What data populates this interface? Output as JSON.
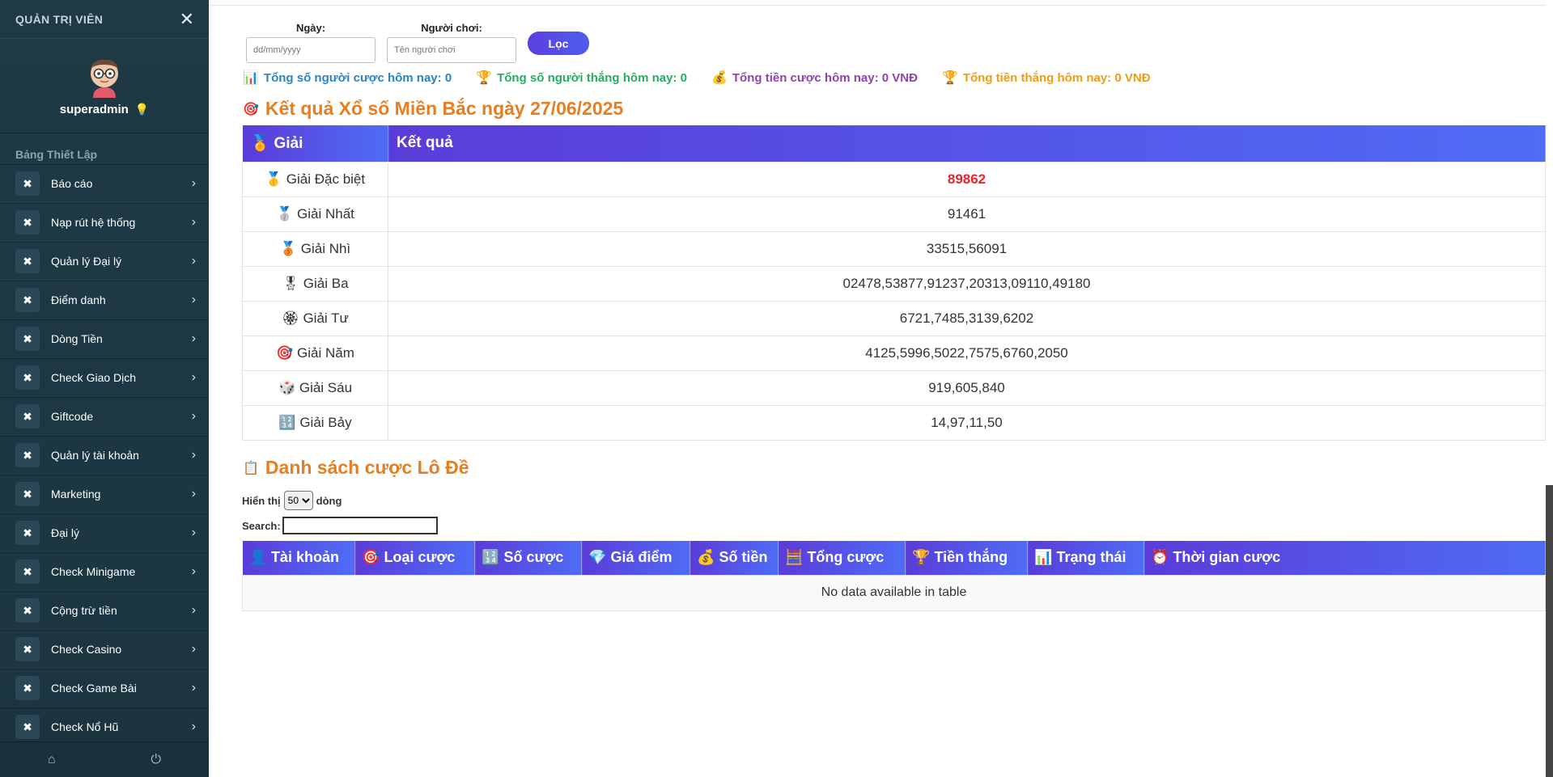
{
  "sidebar": {
    "title": "QUẢN TRỊ VIÊN",
    "username": "superadmin",
    "section": "Bảng Thiết Lập",
    "items": [
      {
        "label": "Báo cáo"
      },
      {
        "label": "Nạp rút hệ thống"
      },
      {
        "label": "Quản lý Đại lý"
      },
      {
        "label": "Điểm danh"
      },
      {
        "label": "Dòng Tiền"
      },
      {
        "label": "Check Giao Dịch"
      },
      {
        "label": "Giftcode"
      },
      {
        "label": "Quản lý tài khoản"
      },
      {
        "label": "Marketing"
      },
      {
        "label": "Đại lý"
      },
      {
        "label": "Check Minigame"
      },
      {
        "label": "Cộng trừ tiền"
      },
      {
        "label": "Check Casino"
      },
      {
        "label": "Check Game Bài"
      },
      {
        "label": "Check Nổ Hũ"
      }
    ]
  },
  "filter": {
    "date_label": "Ngày:",
    "date_placeholder": "dd/mm/yyyy",
    "player_label": "Người chơi:",
    "player_placeholder": "Tên người chơi",
    "button": "Lọc"
  },
  "stats": {
    "bettors": "Tổng số người cược hôm nay: 0",
    "winners": "Tổng số người thắng hôm nay: 0",
    "bet_total": "Tổng tiền cược hôm nay: 0 VNĐ",
    "win_total": "Tổng tiền thắng hôm nay: 0 VNĐ"
  },
  "results": {
    "title": "Kết quả Xổ số Miền Bắc ngày 27/06/2025",
    "col_prize": "Giải",
    "col_result": "Kết quả",
    "rows": [
      {
        "icon": "🥇",
        "prize": "Giải Đặc biệt",
        "value": "89862"
      },
      {
        "icon": "🥈",
        "prize": "Giải Nhất",
        "value": "91461"
      },
      {
        "icon": "🥉",
        "prize": "Giải Nhì",
        "value": "33515,56091"
      },
      {
        "icon": "🎖",
        "prize": "Giải Ba",
        "value": "02478,53877,91237,20313,09110,49180"
      },
      {
        "icon": "🏵",
        "prize": "Giải Tư",
        "value": "6721,7485,3139,6202"
      },
      {
        "icon": "🎯",
        "prize": "Giải Năm",
        "value": "4125,5996,5022,7575,6760,2050"
      },
      {
        "icon": "🎲",
        "prize": "Giải Sáu",
        "value": "919,605,840"
      },
      {
        "icon": "🔢",
        "prize": "Giải Bảy",
        "value": "14,97,11,50"
      }
    ]
  },
  "bets": {
    "title": "Danh sách cược Lô Đề",
    "show_prefix": "Hiển thị",
    "show_value": "50",
    "show_suffix": "dòng",
    "search_label": "Search:",
    "columns": [
      {
        "icon": "👤",
        "label": "Tài khoản"
      },
      {
        "icon": "🎯",
        "label": "Loại cược"
      },
      {
        "icon": "🔢",
        "label": "Số cược"
      },
      {
        "icon": "💎",
        "label": "Giá điểm"
      },
      {
        "icon": "💰",
        "label": "Số tiền"
      },
      {
        "icon": "🧮",
        "label": "Tổng cược"
      },
      {
        "icon": "🏆",
        "label": "Tiền thắng"
      },
      {
        "icon": "📊",
        "label": "Trạng thái"
      },
      {
        "icon": "⏰",
        "label": "Thời gian cược"
      }
    ],
    "empty": "No data available in table"
  }
}
